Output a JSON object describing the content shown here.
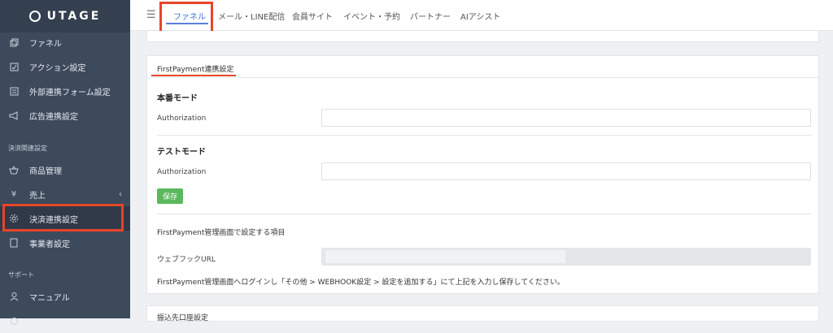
{
  "brand": {
    "name": "UTAGE"
  },
  "sidebar": {
    "items": [
      {
        "label": "ファネル",
        "icon": "funnel-icon"
      },
      {
        "label": "アクション設定",
        "icon": "checklist-icon"
      },
      {
        "label": "外部連携フォーム設定",
        "icon": "form-icon"
      },
      {
        "label": "広告連携設定",
        "icon": "megaphone-icon"
      }
    ],
    "section_payment": "決済関連設定",
    "payment_items": [
      {
        "label": "商品管理",
        "icon": "basket-icon"
      },
      {
        "label": "売上",
        "icon": "yen-icon"
      },
      {
        "label": "決済連携設定",
        "icon": "gear-icon"
      },
      {
        "label": "事業者設定",
        "icon": "building-icon"
      }
    ],
    "section_support": "サポート",
    "support_items": [
      {
        "label": "マニュアル",
        "icon": "person-icon"
      }
    ]
  },
  "topnav": {
    "tabs": [
      {
        "label": "ファネル"
      },
      {
        "label": "メール・LINE配信"
      },
      {
        "label": "会員サイト"
      },
      {
        "label": "イベント・予約"
      },
      {
        "label": "パートナー"
      },
      {
        "label": "AIアシスト"
      }
    ],
    "active_tab": "ファネル"
  },
  "firstpayment": {
    "title": "FirstPayment連携設定",
    "production_mode": "本番モード",
    "production_auth_label": "Authorization",
    "production_auth_value": "",
    "test_mode": "テストモード",
    "test_auth_label": "Authorization",
    "test_auth_value": "",
    "save_label": "保存",
    "manage_heading": "FirstPayment管理画面で設定する項目",
    "webhook_label": "ウェブフックURL",
    "instruction": "FirstPayment管理画面へログインし「その他 > WEBHOOK設定 > 設定を追加する」にて上記を入力し保存してください。"
  },
  "bottom_card": {
    "title": "振込先口座設定"
  },
  "colors": {
    "sidebar_bg": "#3d4a5c",
    "accent_blue": "#3f6fd6",
    "highlight_red": "#e8442a",
    "save_green": "#5cb85c"
  }
}
